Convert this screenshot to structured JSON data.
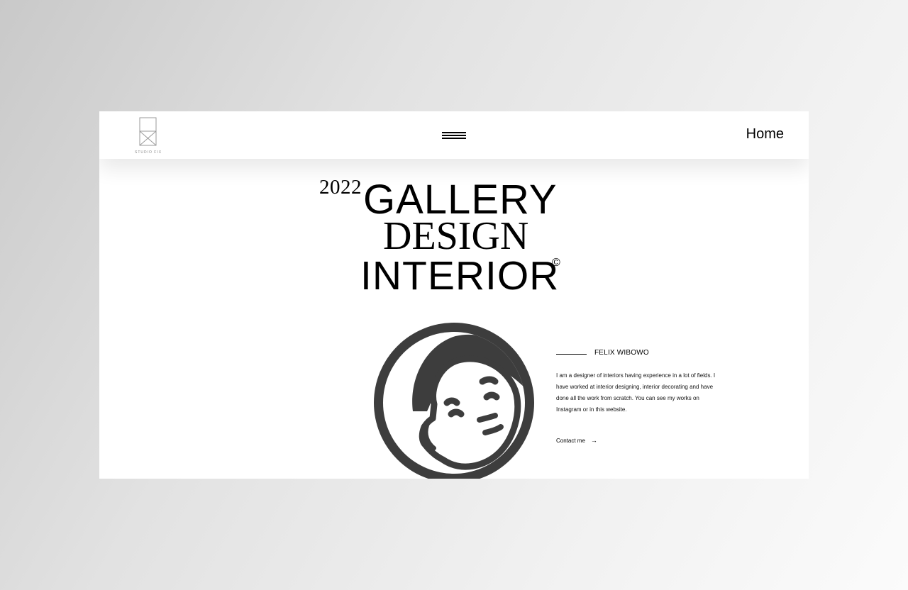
{
  "brand": {
    "logo_text": "STUDIO FIX"
  },
  "nav": {
    "menu_icon": "hamburger-menu-icon",
    "home_label": "Home"
  },
  "hero": {
    "year": "2022",
    "line1": "GALLERY",
    "line2": "DESIGN",
    "line3": "INTERIOR",
    "copyright_symbol": "©"
  },
  "profile": {
    "avatar_icon": "cartoon-face-avatar",
    "name": "FELIX WIBOWO",
    "bio": "I am a designer of interiors having experience in a lot of fields. I have worked at interior designing, interior decorating and have done all the work from scratch. You can see my works on Instagram or in this website.",
    "contact_label": "Contact me",
    "contact_icon": "arrow-right-icon"
  },
  "colors": {
    "avatar": "#3d3d3d",
    "text": "#000000",
    "background": "#ffffff"
  }
}
